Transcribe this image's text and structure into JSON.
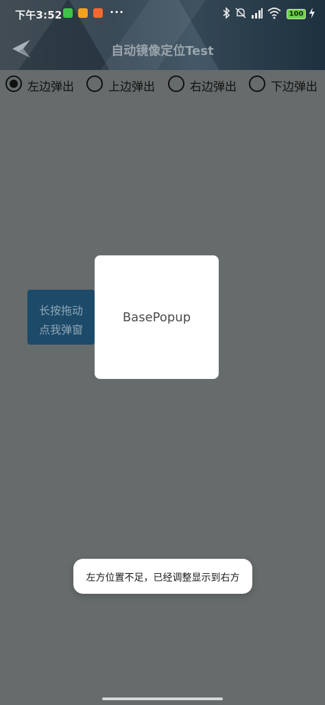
{
  "status_bar": {
    "time": "下午3:52",
    "dots": "···",
    "battery": "100",
    "app_icons": [
      "wechat-icon",
      "messages-icon",
      "shop-icon"
    ],
    "app_icon_colors": [
      "#3ec34a",
      "#f4a11d",
      "#f26a2e"
    ]
  },
  "toolbar": {
    "title": "自动镜像定位Test",
    "back_icon": "back-arrow-icon"
  },
  "radio_group": {
    "options": [
      {
        "label": "左边弹出",
        "checked": true
      },
      {
        "label": "上边弹出",
        "checked": false
      },
      {
        "label": "右边弹出",
        "checked": false
      },
      {
        "label": "下边弹出",
        "checked": false
      }
    ]
  },
  "anchor_button": {
    "line1": "长按拖动",
    "line2": "点我弹窗"
  },
  "popup": {
    "text": "BasePopup"
  },
  "toast": {
    "text": "左方位置不足，已经调整显示到右方"
  },
  "colors": {
    "background": "#666b6b",
    "anchor_button": "#1c4a68",
    "battery": "#6ed04a"
  }
}
